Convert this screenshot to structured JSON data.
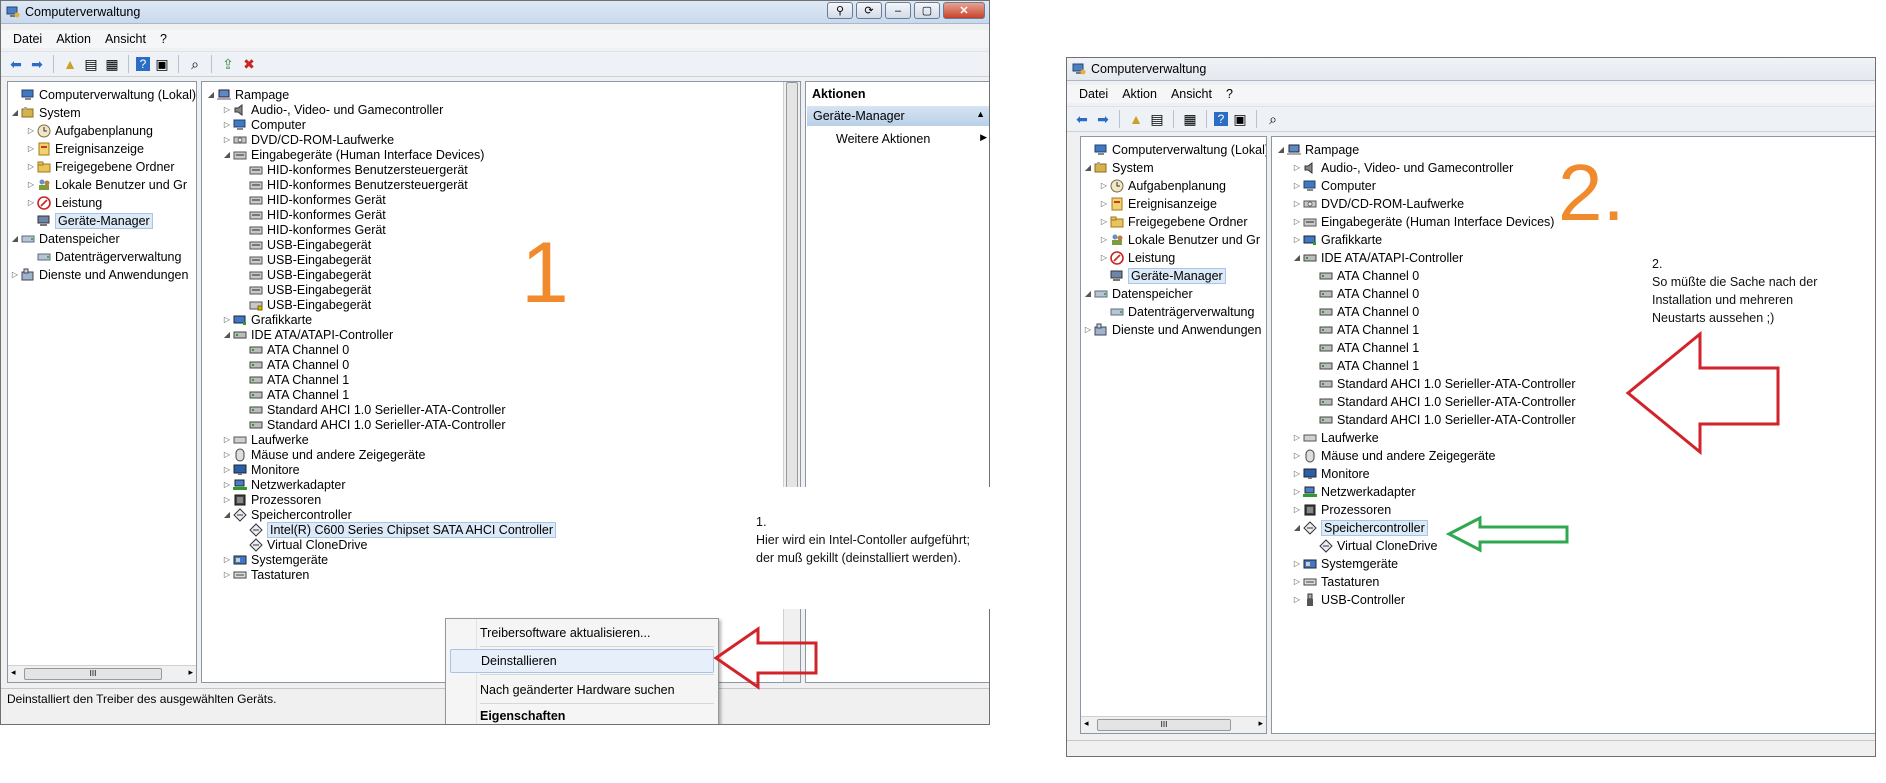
{
  "window1": {
    "title": "Computerverwaltung",
    "menu": [
      "Datei",
      "Aktion",
      "Ansicht",
      "?"
    ],
    "nav_tree": [
      "Computerverwaltung (Lokal)",
      "System",
      "Aufgabenplanung",
      "Ereignisanzeige",
      "Freigegebene Ordner",
      "Lokale Benutzer und Gr",
      "Leistung",
      "Geräte-Manager",
      "Datenspeicher",
      "Datenträgerverwaltung",
      "Dienste und Anwendungen"
    ],
    "device_tree": [
      "Rampage",
      "Audio-, Video- und Gamecontroller",
      "Computer",
      "DVD/CD-ROM-Laufwerke",
      "Eingabegeräte (Human Interface Devices)",
      "HID-konformes Benutzersteuergerät",
      "HID-konformes Benutzersteuergerät",
      "HID-konformes Gerät",
      "HID-konformes Gerät",
      "HID-konformes Gerät",
      "USB-Eingabegerät",
      "USB-Eingabegerät",
      "USB-Eingabegerät",
      "USB-Eingabegerät",
      "USB-Eingabegerät",
      "Grafikkarte",
      "IDE ATA/ATAPI-Controller",
      "ATA Channel 0",
      "ATA Channel 0",
      "ATA Channel 1",
      "ATA Channel 1",
      "Standard AHCI 1.0 Serieller-ATA-Controller",
      "Standard AHCI 1.0 Serieller-ATA-Controller",
      "Laufwerke",
      "Mäuse und andere Zeigegeräte",
      "Monitore",
      "Netzwerkadapter",
      "Prozessoren",
      "Speichercontroller",
      "Intel(R) C600 Series Chipset SATA AHCI Controller",
      "Virtual CloneDrive",
      "Systemgeräte",
      "Tastaturen"
    ],
    "actions_title": "Aktionen",
    "actions_section": "Geräte-Manager",
    "actions_more": "Weitere Aktionen",
    "context_menu": [
      "Treibersoftware aktualisieren...",
      "Deinstallieren",
      "Nach geänderter Hardware suchen",
      "Eigenschaften"
    ],
    "status": "Deinstalliert den Treiber des ausgewählten Geräts.",
    "scroll_glyph": "III"
  },
  "window2": {
    "title": "Computerverwaltung",
    "menu": [
      "Datei",
      "Aktion",
      "Ansicht",
      "?"
    ],
    "nav_tree": [
      "Computerverwaltung (Lokal)",
      "System",
      "Aufgabenplanung",
      "Ereignisanzeige",
      "Freigegebene Ordner",
      "Lokale Benutzer und Gr",
      "Leistung",
      "Geräte-Manager",
      "Datenspeicher",
      "Datenträgerverwaltung",
      "Dienste und Anwendungen"
    ],
    "device_tree": [
      "Rampage",
      "Audio-, Video- und Gamecontroller",
      "Computer",
      "DVD/CD-ROM-Laufwerke",
      "Eingabegeräte (Human Interface Devices)",
      "Grafikkarte",
      "IDE ATA/ATAPI-Controller",
      "ATA Channel 0",
      "ATA Channel 0",
      "ATA Channel 0",
      "ATA Channel 1",
      "ATA Channel 1",
      "ATA Channel 1",
      "Standard AHCI 1.0 Serieller-ATA-Controller",
      "Standard AHCI 1.0 Serieller-ATA-Controller",
      "Standard AHCI 1.0 Serieller-ATA-Controller",
      "Laufwerke",
      "Mäuse und andere Zeigegeräte",
      "Monitore",
      "Netzwerkadapter",
      "Prozessoren",
      "Speichercontroller",
      "Virtual CloneDrive",
      "Systemgeräte",
      "Tastaturen",
      "USB-Controller"
    ],
    "scroll_glyph": "III"
  },
  "annotations": {
    "step1_number": "1",
    "step1_text": [
      "1.",
      "Hier wird ein Intel-Contoller aufgeführt;",
      "der muß gekillt (deinstalliert werden)."
    ],
    "step2_number": "2.",
    "step2_text": [
      "2.",
      "So müßte die Sache nach der",
      "Installation und mehreren",
      "Neustarts aussehen ;)"
    ],
    "arrow_colors": {
      "red": "#d2232a",
      "green": "#2fa84f"
    },
    "number_color": "#f08a2c"
  }
}
